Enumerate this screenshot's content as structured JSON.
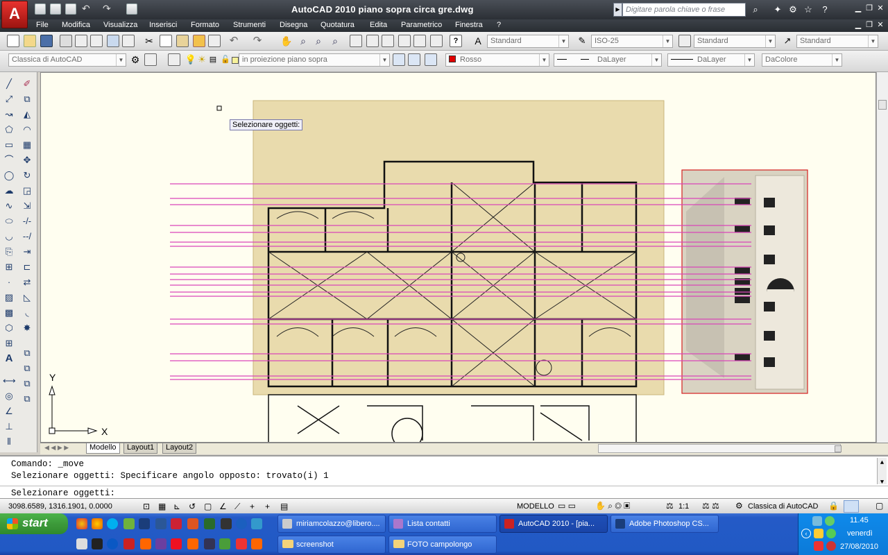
{
  "window": {
    "title": "AutoCAD 2010    piano sopra circa gre.dwg",
    "search_placeholder": "Digitare parola chiave o frase"
  },
  "menu": [
    "File",
    "Modifica",
    "Visualizza",
    "Inserisci",
    "Formato",
    "Strumenti",
    "Disegna",
    "Quotatura",
    "Edita",
    "Parametrico",
    "Finestra",
    "?"
  ],
  "toolbar2": {
    "text_style": "Standard",
    "dim_style": "ISO-25",
    "table_style": "Standard",
    "mleader_style": "Standard"
  },
  "toolbar3": {
    "workspace": "Classica di AutoCAD",
    "layer": "in proiezione piano sopra",
    "color": "Rosso",
    "linetype": "DaLayer",
    "lineweight": "DaLayer",
    "plotstyle": "DaColore"
  },
  "tooltip": "Selezionare oggetti:",
  "ucs": {
    "x": "X",
    "y": "Y"
  },
  "tabs": [
    "Modello",
    "Layout1",
    "Layout2"
  ],
  "command": {
    "line1": "Comando: _move",
    "line2": "Selezionare oggetti: Specificare angolo opposto: trovato(i) 1",
    "prompt": "Selezionare oggetti:"
  },
  "status": {
    "coords": "3098.6589, 1316.1901, 0.0000",
    "space": "MODELLO",
    "scale": "1:1",
    "workspace": "Classica di AutoCAD"
  },
  "taskbar": {
    "start": "start",
    "tasks_row1": [
      "miriamcolazzo@libero....",
      "Lista contatti",
      "AutoCAD 2010 - [pia...",
      "Adobe Photoshop CS..."
    ],
    "tasks_row2": [
      "screenshot",
      "FOTO campolongo"
    ],
    "clock": {
      "time": "11.45",
      "day": "venerdì",
      "date": "27/08/2010"
    }
  },
  "colors": {
    "title_bg": "#2e3238",
    "canvas_bg": "#fffef0",
    "magenta": "#d946b9",
    "taskbar": "#245ac7",
    "start": "#3d9a3a",
    "red_color": "#e00000"
  }
}
